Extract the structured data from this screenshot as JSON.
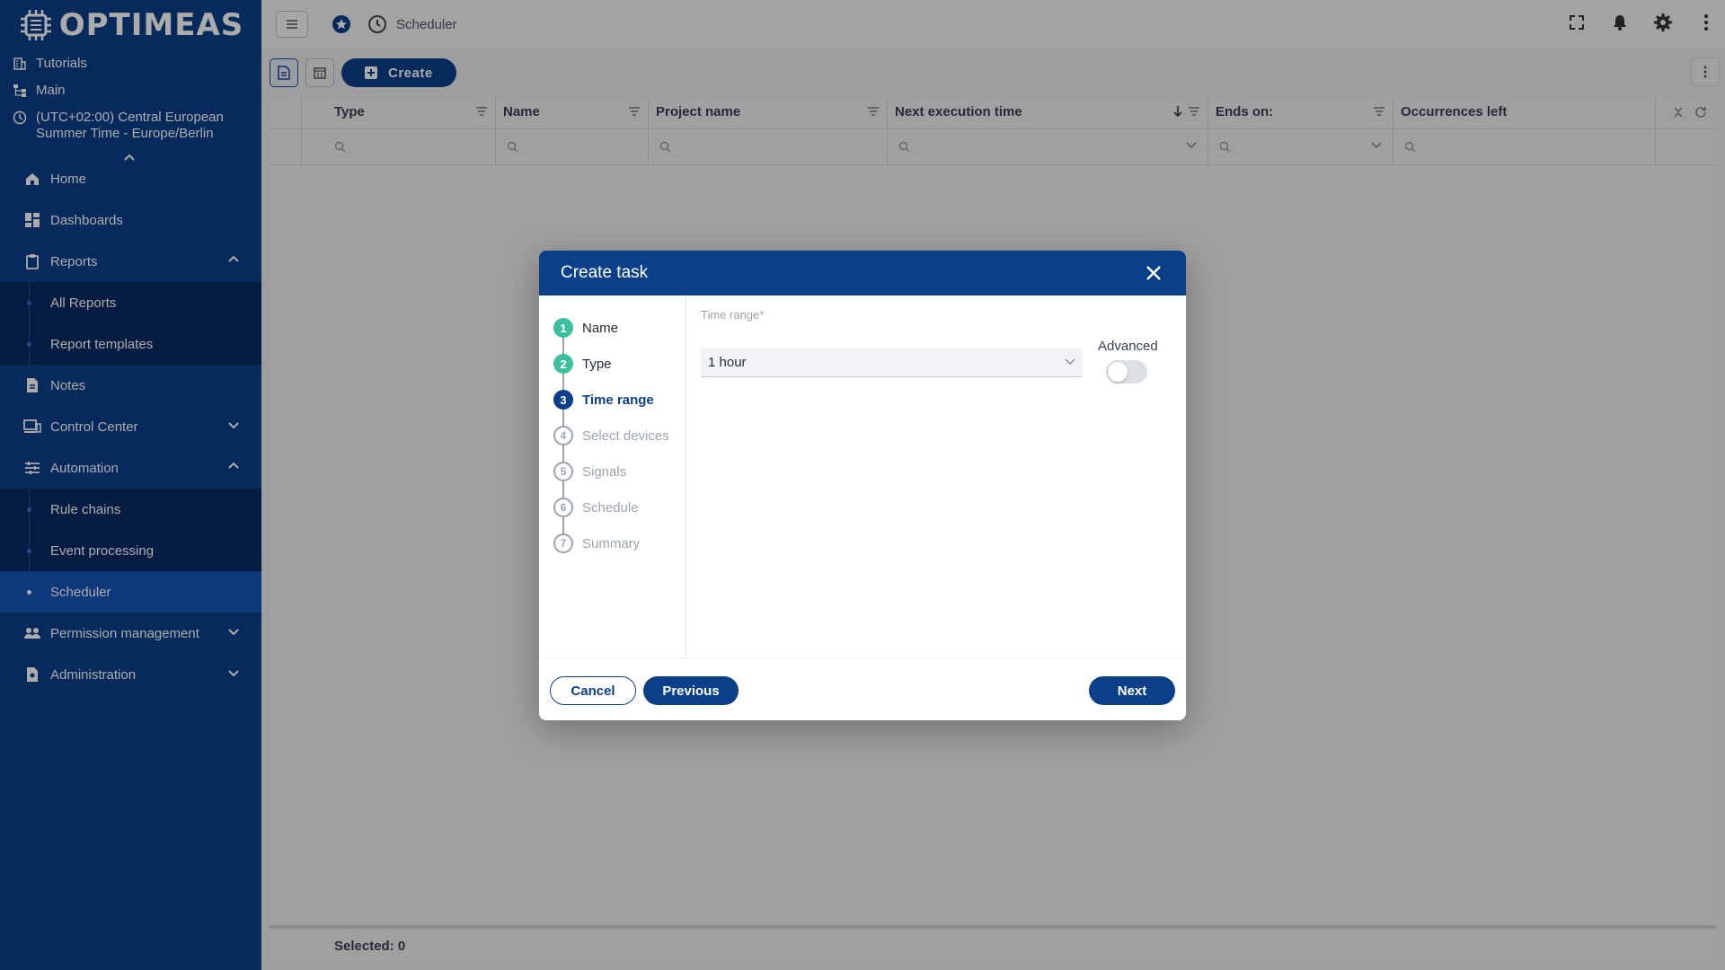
{
  "sidebar": {
    "logo_text": "OPTIMEAS",
    "meta": {
      "tutorials": "Tutorials",
      "main": "Main",
      "timezone_line1": "(UTC+02:00) Central European",
      "timezone_line2": "Summer Time - Europe/Berlin"
    },
    "nav": {
      "home": "Home",
      "dashboards": "Dashboards",
      "reports": "Reports",
      "all_reports": "All Reports",
      "report_templates": "Report templates",
      "notes": "Notes",
      "control_center": "Control Center",
      "automation": "Automation",
      "rule_chains": "Rule chains",
      "event_processing": "Event processing",
      "scheduler": "Scheduler",
      "permission_management": "Permission management",
      "administration": "Administration"
    }
  },
  "topbar": {
    "breadcrumb": "Scheduler"
  },
  "toolbar": {
    "create_label": "Create"
  },
  "grid": {
    "columns": [
      "Type",
      "Name",
      "Project name",
      "Next execution time",
      "Ends on:",
      "Occurrences left"
    ],
    "sort_column": "Next execution time",
    "footer": "Selected: 0"
  },
  "dialog": {
    "title": "Create task",
    "steps": [
      {
        "num": "1",
        "label": "Name",
        "state": "done"
      },
      {
        "num": "2",
        "label": "Type",
        "state": "done"
      },
      {
        "num": "3",
        "label": "Time range",
        "state": "current"
      },
      {
        "num": "4",
        "label": "Select devices",
        "state": "todo"
      },
      {
        "num": "5",
        "label": "Signals",
        "state": "todo"
      },
      {
        "num": "6",
        "label": "Schedule",
        "state": "todo"
      },
      {
        "num": "7",
        "label": "Summary",
        "state": "todo"
      }
    ],
    "field_label": "Time range*",
    "time_range_value": "1 hour",
    "advanced_label": "Advanced",
    "advanced_on": false,
    "cancel": "Cancel",
    "previous": "Previous",
    "next": "Next"
  },
  "colors": {
    "brand": "#0b3f8a",
    "step_done": "#3cbf9e"
  }
}
